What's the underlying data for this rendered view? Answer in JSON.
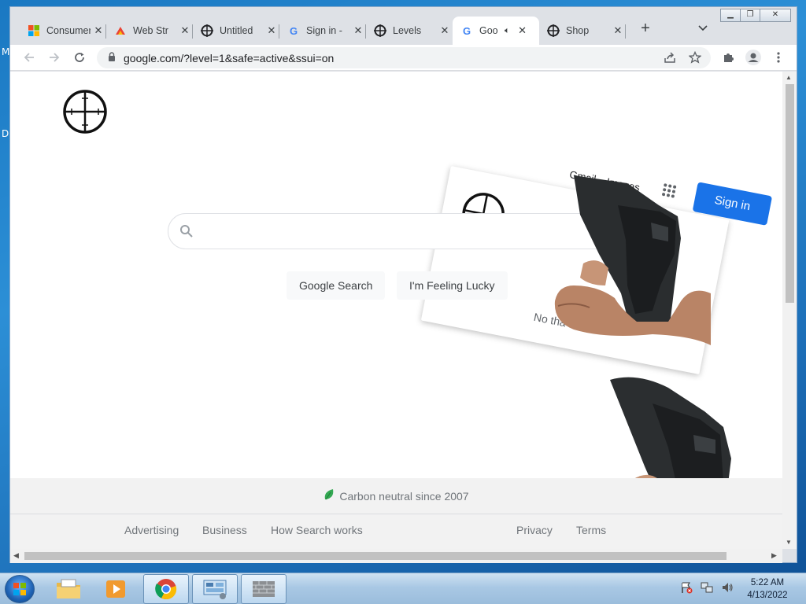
{
  "desktop": {
    "edge_letters": [
      "M",
      "D"
    ]
  },
  "browser": {
    "tabs": [
      {
        "title": "Consumer",
        "favicon": "microsoft-icon"
      },
      {
        "title": "Web Str",
        "favicon": "web-icon"
      },
      {
        "title": "Untitled",
        "favicon": "crosshair-icon"
      },
      {
        "title": "Sign in -",
        "favicon": "google-icon"
      },
      {
        "title": "Levels",
        "favicon": "crosshair-icon"
      },
      {
        "title": "Goo",
        "favicon": "google-icon",
        "active": true,
        "audio": true
      },
      {
        "title": "Shop",
        "favicon": "crosshair-icon"
      }
    ],
    "url": "google.com/?level=1&safe=active&ssui=on"
  },
  "page": {
    "header_links": {
      "gmail": "Gmail",
      "images": "Images",
      "sign_in": "Sign in"
    },
    "overlay_text": "No tha",
    "search": {
      "placeholder": "",
      "google_search": "Google Search",
      "feeling_lucky": "I'm Feeling Lucky"
    },
    "footer": {
      "carbon": "Carbon neutral since 2007",
      "advertising": "Advertising",
      "business": "Business",
      "how_search": "How Search works",
      "privacy": "Privacy",
      "terms": "Terms"
    }
  },
  "taskbar": {
    "time": "5:22 AM",
    "date": "4/13/2022"
  },
  "colors": {
    "accent": "#1a73e8",
    "google_blue": "#4285f4",
    "google_red": "#ea4335",
    "leaf_green": "#34a853"
  }
}
